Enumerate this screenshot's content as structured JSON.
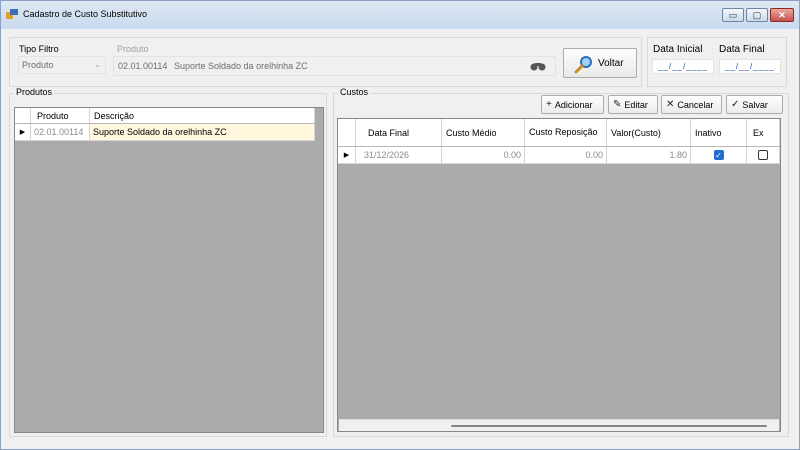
{
  "window": {
    "title": "Cadastro de Custo Substitutivo",
    "min_glyph": "▭",
    "max_glyph": "▢",
    "close_glyph": "✕"
  },
  "filter": {
    "tipo_label": "Tipo Filtro",
    "tipo_value": "Produto",
    "produto_label": "Produto",
    "produto_code": "02.01.00114",
    "produto_desc": "Suporte Soldado da orelhinha ZC",
    "search_icon": "binoculars-icon"
  },
  "voltar_button": {
    "label": "Voltar",
    "icon": "magnifier-icon"
  },
  "dates": {
    "inicial_label": "Data Inicial",
    "final_label": "Data Final",
    "inicial_value": "__/__/____",
    "final_value": "__/__/____"
  },
  "produtos": {
    "title": "Produtos",
    "columns": [
      "Produto",
      "Descrição"
    ],
    "rows": [
      {
        "selector": "▶",
        "produto": "02.01.00114",
        "descricao": "Suporte Soldado da orelhinha ZC"
      }
    ]
  },
  "custos": {
    "title": "Custos",
    "toolbar": {
      "add_glyph": "+",
      "add_label": "Adicionar",
      "edit_glyph": "✎",
      "edit_label": "Editar",
      "cancel_glyph": "✕",
      "cancel_label": "Cancelar",
      "save_glyph": "✓",
      "save_label": "Salvar"
    },
    "columns": [
      "Data Final",
      "Custo Médio",
      "Custo Reposição",
      "Valor(Custo)",
      "Inativo",
      "Ex"
    ],
    "rows": [
      {
        "selector": "▶",
        "data_final": "31/12/2026",
        "custo_medio": "0.00",
        "custo_reposicao": "0.00",
        "valor_custo": "1.80",
        "inativo": true,
        "ex": false
      }
    ]
  },
  "colors": {
    "accent": "#1e6fd0",
    "grid_bg": "#ababab",
    "selected_row": "#fff8dc"
  }
}
